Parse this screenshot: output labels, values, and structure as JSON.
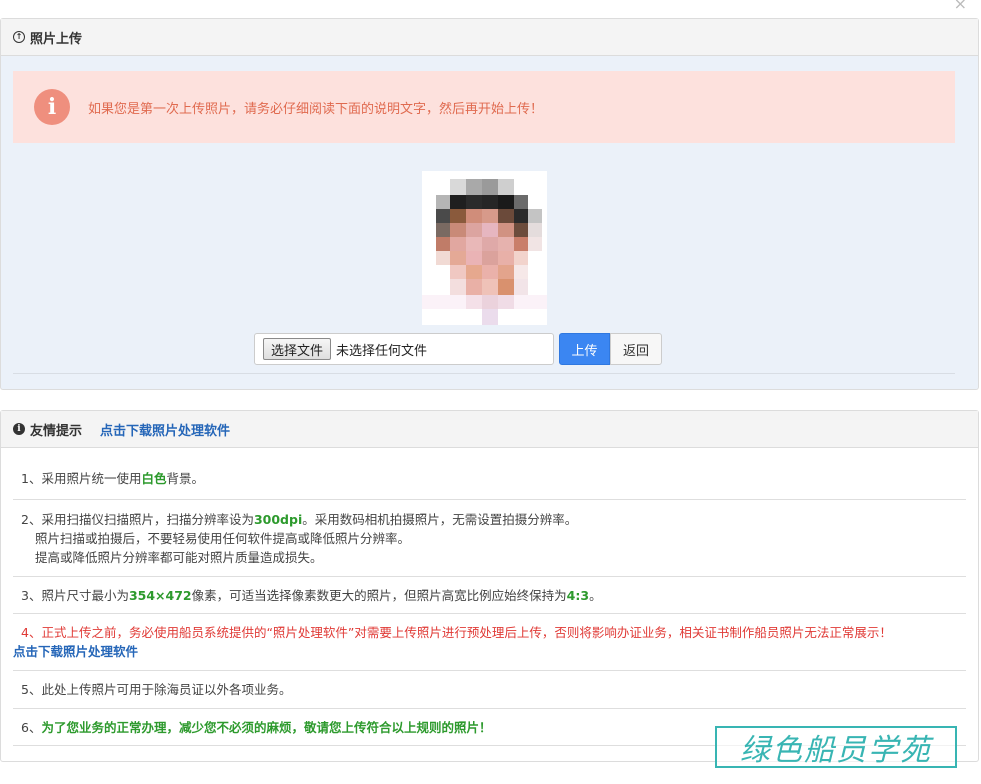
{
  "dialog": {
    "close_icon": "×"
  },
  "upload_panel": {
    "title": "照片上传",
    "alert": "如果您是第一次上传照片，请务必仔细阅读下面的说明文字，然后再开始上传！",
    "choose_label": "选择文件",
    "no_file_text": "未选择任何文件",
    "upload_label": "上传",
    "back_label": "返回"
  },
  "tips_panel": {
    "title": "友情提示",
    "download_link": "点击下载照片处理软件",
    "tips": [
      {
        "parts": [
          "1、采用照片统一使用",
          "白色",
          "背景。"
        ]
      },
      {
        "line1": [
          "2、采用扫描仪扫描照片，扫描分辨率设为",
          "300dpi",
          "。采用数码相机拍摄照片，无需设置拍摄分辨率。"
        ],
        "line2": "照片扫描或拍摄后，不要轻易使用任何软件提高或降低照片分辨率。",
        "line3": "提高或降低照片分辨率都可能对照片质量造成损失。"
      },
      {
        "parts": [
          "3、照片尺寸最小为",
          "354×472",
          "像素，可适当选择像素数更大的照片，但照片高宽比例应始终保持为",
          "4:3",
          "。"
        ]
      },
      {
        "red": "4、正式上传之前，务必使用船员系统提供的“照片处理软件”对需要上传照片进行预处理后上传，否则将影响办证业务，相关证书制作船员照片无法正常展示！",
        "link": "点击下载照片处理软件"
      },
      {
        "text": "5、此处上传照片可用于除海员证以外各项业务。"
      },
      {
        "prefix": "6、",
        "green": "为了您业务的正常办理，减少您不必须的麻烦，敬请您上传符合以上规则的照片！"
      }
    ]
  },
  "watermark": "绿色船员学苑",
  "colors": {
    "accent": "#3b86f2",
    "alert_bg": "#fde1dd",
    "alert_text": "#e06a4f",
    "link": "#2566b8",
    "green": "#2d9a2d",
    "red": "#e03a36"
  }
}
